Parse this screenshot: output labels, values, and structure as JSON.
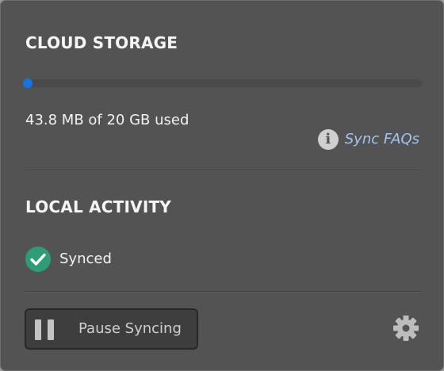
{
  "cloud_storage": {
    "title": "CLOUD STORAGE",
    "usage_fraction": 0.0021,
    "usage_text": "43.8 MB of 20 GB used",
    "faq_link_label": "Sync FAQs",
    "faq_icon": "info-icon"
  },
  "local_activity": {
    "title": "LOCAL ACTIVITY",
    "status_icon": "check-circle-icon",
    "status_label": "Synced"
  },
  "footer": {
    "pause_button_label": "Pause Syncing",
    "pause_icon": "pause-icon",
    "settings_icon": "gear-icon"
  },
  "colors": {
    "panel_background": "#535353",
    "progress_fill": "#1473e6",
    "link": "#9fc5f0",
    "success": "#2d9d78"
  }
}
